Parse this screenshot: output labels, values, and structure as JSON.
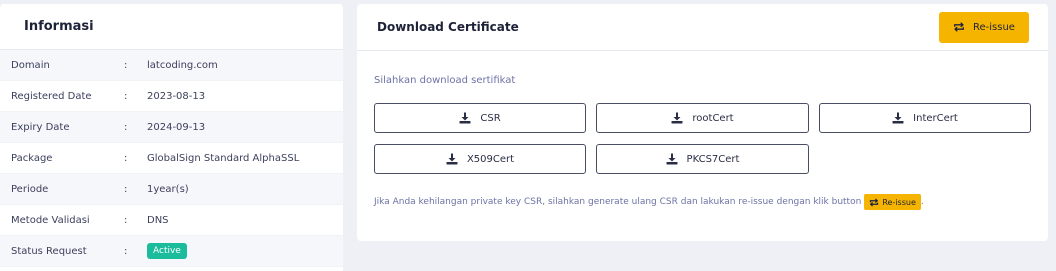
{
  "info": {
    "title": "Informasi",
    "rows": [
      {
        "label": "Domain",
        "value": "latcoding.com"
      },
      {
        "label": "Registered Date",
        "value": "2023-08-13"
      },
      {
        "label": "Expiry Date",
        "value": "2024-09-13"
      },
      {
        "label": "Package",
        "value": "GlobalSign Standard AlphaSSL"
      },
      {
        "label": "Periode",
        "value": "1year(s)"
      },
      {
        "label": "Metode Validasi",
        "value": "DNS"
      },
      {
        "label": "Status Request",
        "value": "Active"
      }
    ],
    "separator": ":"
  },
  "download": {
    "title": "Download Certificate",
    "reissue_label": "Re-issue",
    "intro": "Silahkan download sertifikat",
    "buttons": [
      "CSR",
      "rootCert",
      "InterCert",
      "X509Cert",
      "PKCS7Cert"
    ],
    "note": "Jika Anda kehilangan private key CSR, silahkan generate ulang CSR dan lakukan re-issue dengan klik button",
    "note_button": "Re-issue",
    "note_end": "."
  },
  "icons": {
    "reissue": "repeat-icon",
    "download": "download-icon"
  },
  "colors": {
    "accent": "#f5b400",
    "status_active": "#1abc9c",
    "background": "#eef0f5"
  }
}
